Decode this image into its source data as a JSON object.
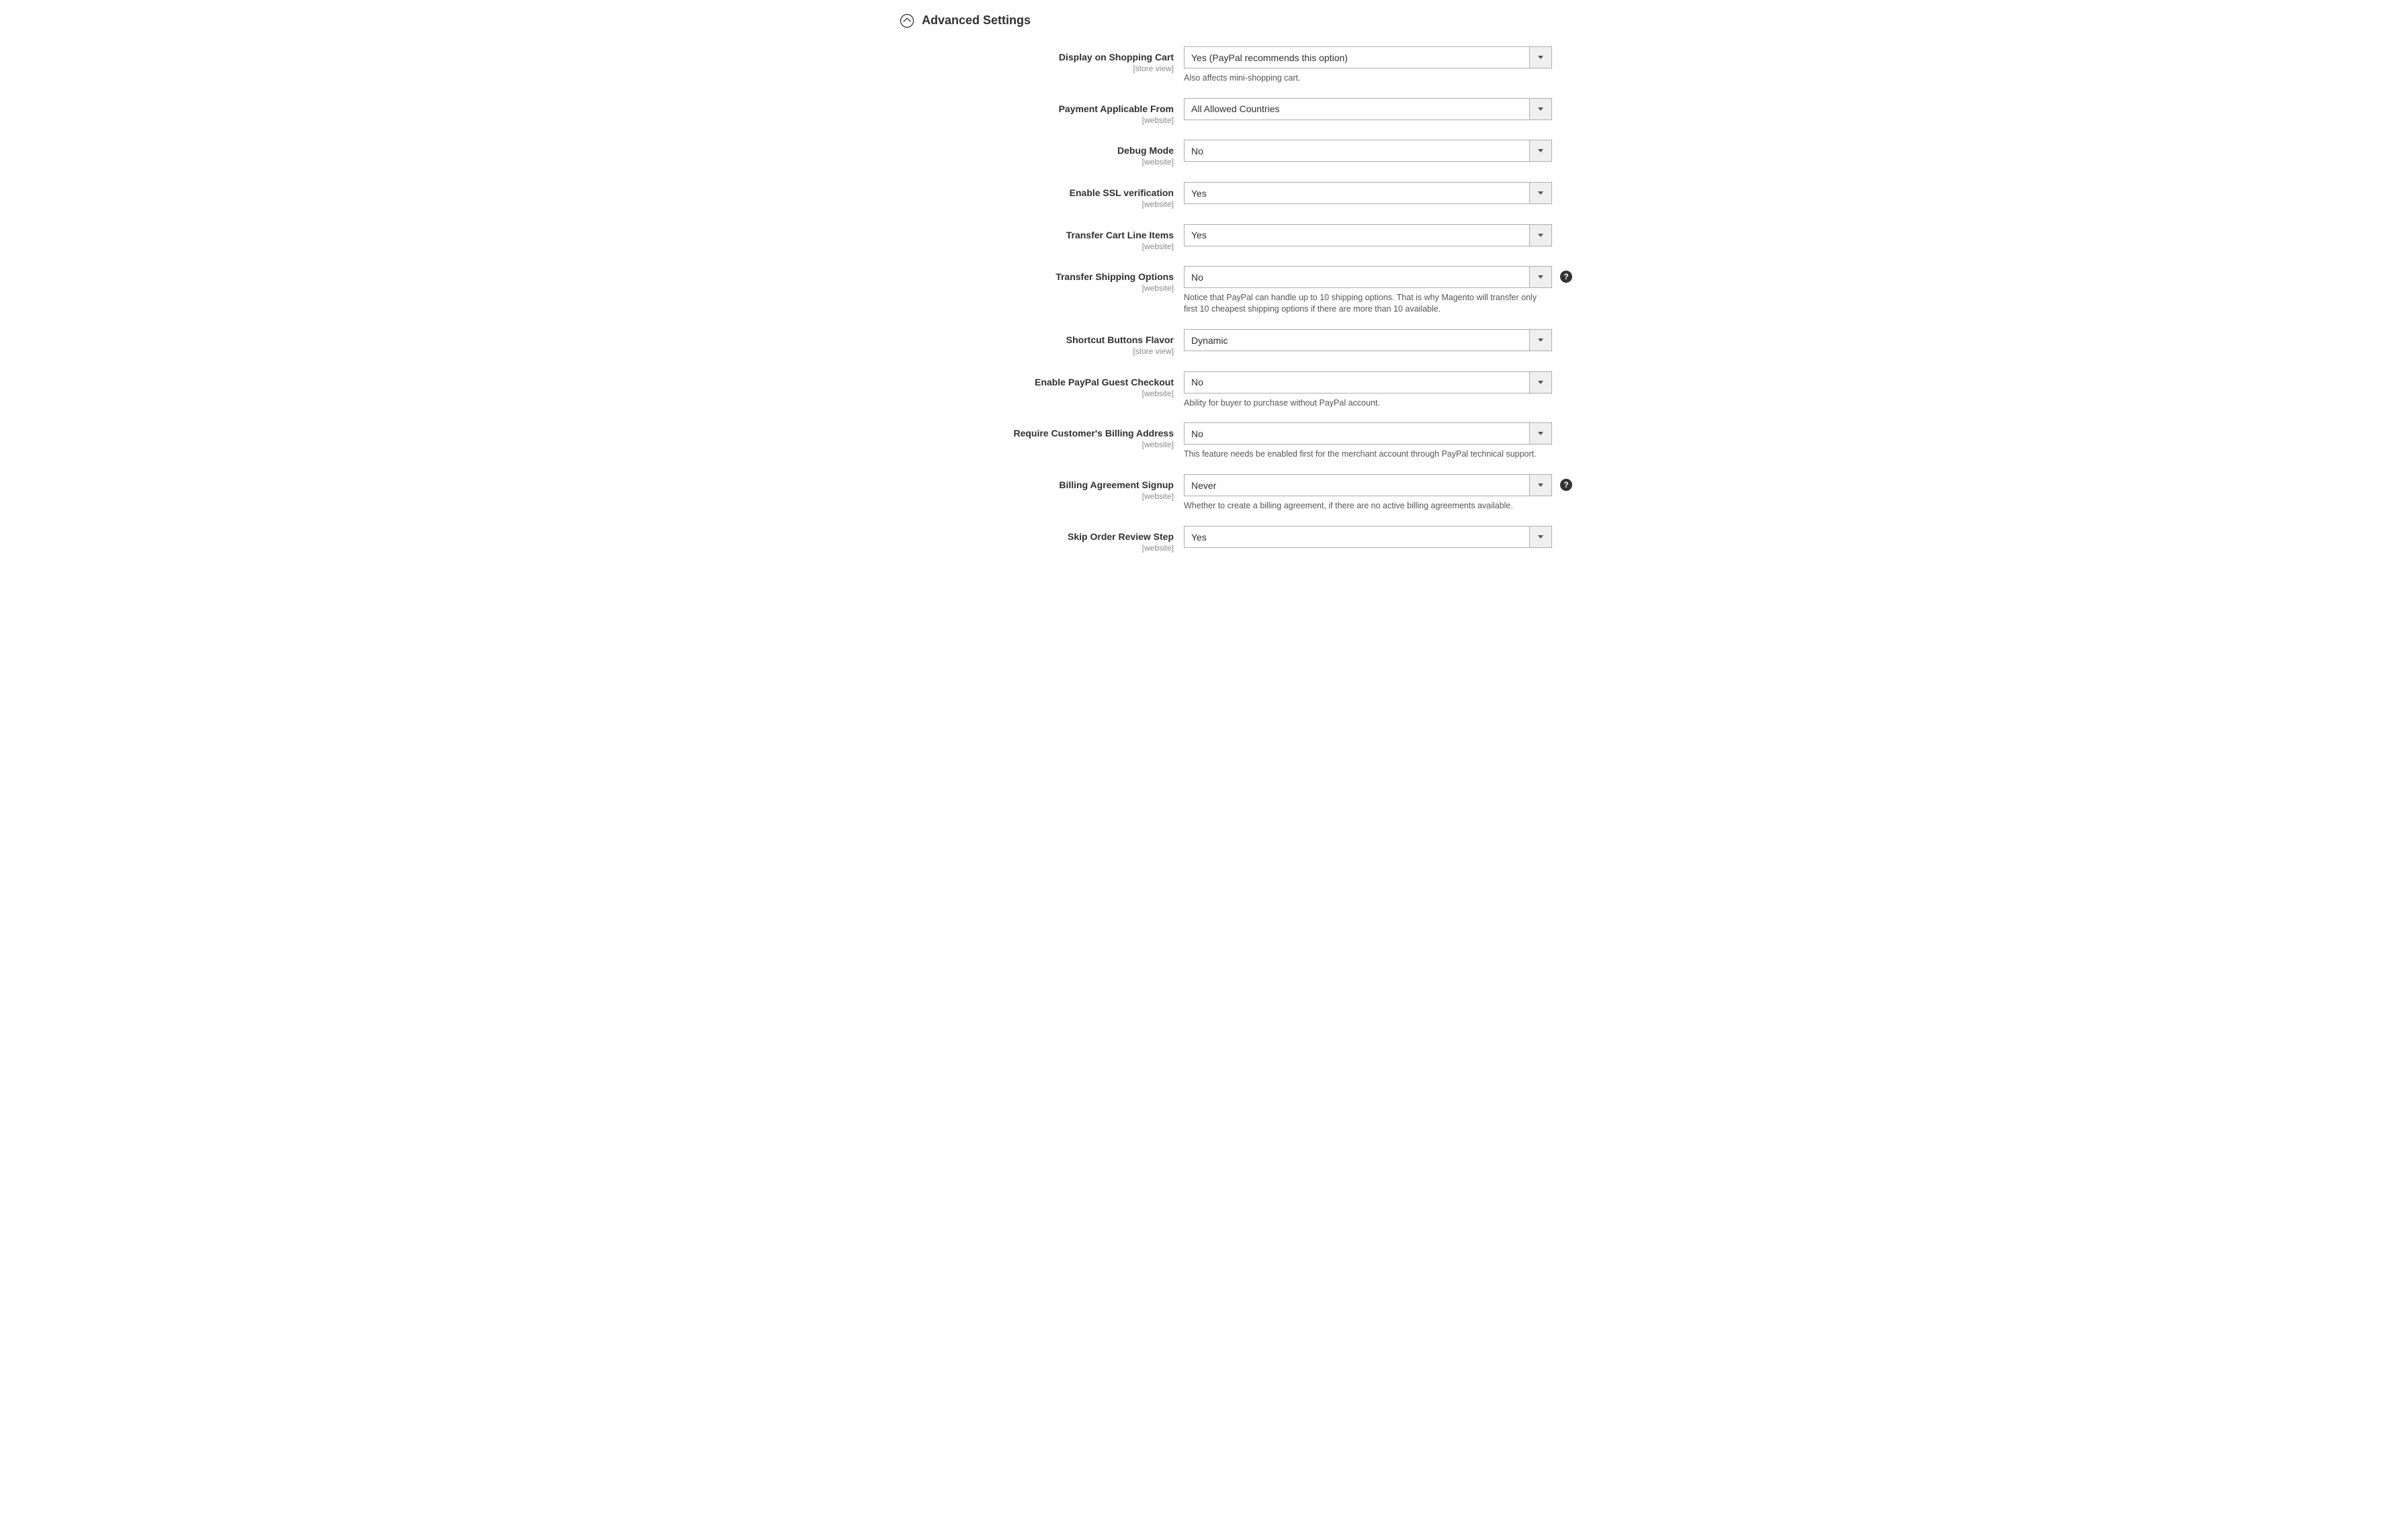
{
  "section": {
    "title": "Advanced Settings"
  },
  "scopes": {
    "store_view": "[store view]",
    "website": "[website]"
  },
  "fields": {
    "display_cart": {
      "label": "Display on Shopping Cart",
      "value": "Yes (PayPal recommends this option)",
      "help": "Also affects mini-shopping cart."
    },
    "payment_applicable": {
      "label": "Payment Applicable From",
      "value": "All Allowed Countries"
    },
    "debug_mode": {
      "label": "Debug Mode",
      "value": "No"
    },
    "ssl_verify": {
      "label": "Enable SSL verification",
      "value": "Yes"
    },
    "transfer_line_items": {
      "label": "Transfer Cart Line Items",
      "value": "Yes"
    },
    "transfer_shipping": {
      "label": "Transfer Shipping Options",
      "value": "No",
      "help": "Notice that PayPal can handle up to 10 shipping options. That is why Magento will transfer only first 10 cheapest shipping options if there are more than 10 available."
    },
    "shortcut_flavor": {
      "label": "Shortcut Buttons Flavor",
      "value": "Dynamic"
    },
    "guest_checkout": {
      "label": "Enable PayPal Guest Checkout",
      "value": "No",
      "help": "Ability for buyer to purchase without PayPal account."
    },
    "billing_address": {
      "label": "Require Customer's Billing Address",
      "value": "No",
      "help": "This feature needs be enabled first for the merchant account through PayPal technical support."
    },
    "billing_agreement": {
      "label": "Billing Agreement Signup",
      "value": "Never",
      "help": "Whether to create a billing agreement, if there are no active billing agreements available."
    },
    "skip_review": {
      "label": "Skip Order Review Step",
      "value": "Yes"
    }
  }
}
